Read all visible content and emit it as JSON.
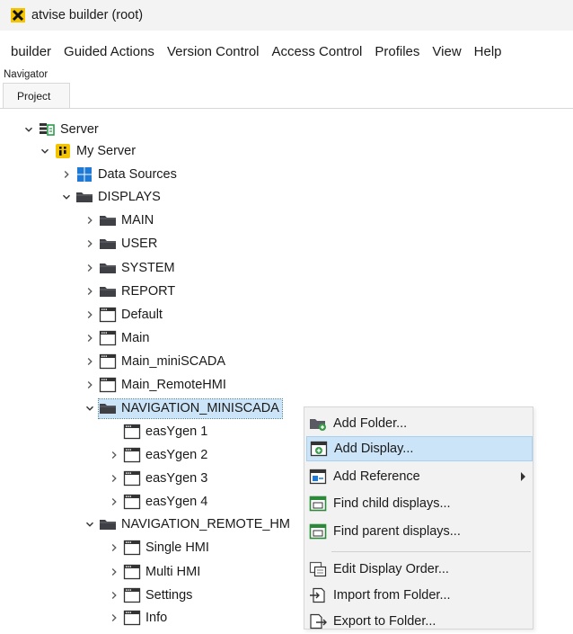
{
  "window": {
    "title": "atvise builder  (root)"
  },
  "menu": [
    "builder",
    "Guided Actions",
    "Version Control",
    "Access Control",
    "Profiles",
    "View",
    "Help"
  ],
  "navigator": {
    "title": "Navigator",
    "tab": "Project"
  },
  "tree": {
    "server": "Server",
    "my_server": "My Server",
    "data_sources": "Data Sources",
    "displays": "DISPLAYS",
    "main_folder": "MAIN",
    "user_folder": "USER",
    "system_folder": "SYSTEM",
    "report_folder": "REPORT",
    "default_display": "Default",
    "main_display": "Main",
    "main_miniscada": "Main_miniSCADA",
    "main_remotehmi": "Main_RemoteHMI",
    "navigation_miniscada": "NAVIGATION_MINISCADA",
    "easygen1": "easYgen 1",
    "easygen2": "easYgen 2",
    "easygen3": "easYgen 3",
    "easygen4": "easYgen 4",
    "navigation_remote": "NAVIGATION_REMOTE_HM",
    "single_hmi": "Single HMI",
    "multi_hmi": "Multi HMI",
    "settings": "Settings",
    "info": "Info"
  },
  "context_menu": {
    "add_folder": "Add Folder...",
    "add_display": "Add Display...",
    "add_reference": "Add Reference",
    "find_child": "Find child displays...",
    "find_parent": "Find parent displays...",
    "edit_order": "Edit Display Order...",
    "import_folder": "Import from Folder...",
    "export_folder": "Export to Folder..."
  },
  "colors": {
    "logo_yellow": "#f5c400",
    "selection": "#cce4f7",
    "folder": "#3f3f46",
    "data_sources_blue": "#1e7ad6",
    "menu_bg": "#f2f2f2"
  }
}
